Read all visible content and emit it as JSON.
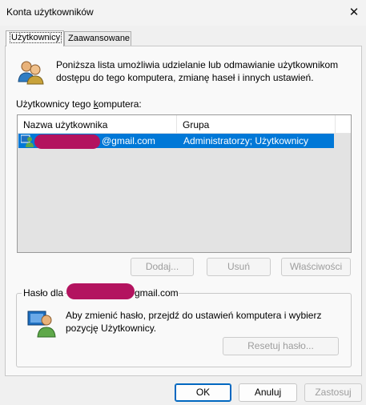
{
  "window": {
    "title": "Konta użytkowników",
    "close_glyph": "✕"
  },
  "tabs": [
    {
      "label": "Użytkownicy",
      "active": true
    },
    {
      "label": "Zaawansowane",
      "active": false
    }
  ],
  "intro": {
    "icon": "users-icon",
    "text": "Poniższa lista umożliwia udzielanie lub odmawianie użytkownikom dostępu do tego komputera, zmianę haseł i innych ustawień."
  },
  "users_list": {
    "label_before": "Użytkownicy tego ",
    "label_underlined": "k",
    "label_after": "omputera:",
    "columns": [
      "Nazwa użytkownika",
      "Grupa"
    ],
    "rows": [
      {
        "user_suffix": "@gmail.com",
        "group": "Administratorzy; Użytkownicy",
        "selected": true
      }
    ]
  },
  "list_buttons": {
    "add": "Dodaj...",
    "remove": "Usuń",
    "properties": "Właściwości"
  },
  "password_group": {
    "label_prefix": "Hasło dla",
    "label_suffix": "gmail.com",
    "icon": "user-icon",
    "text": "Aby zmienić hasło, przejdź do ustawień komputera i wybierz pozycję Użytkownicy.",
    "reset_button": "Resetuj hasło..."
  },
  "dialog_buttons": {
    "ok": "OK",
    "cancel": "Anuluj",
    "apply": "Zastosuj"
  },
  "colors": {
    "selection": "#0078d7",
    "redaction": "#b3135f",
    "accent": "#0067c0"
  }
}
